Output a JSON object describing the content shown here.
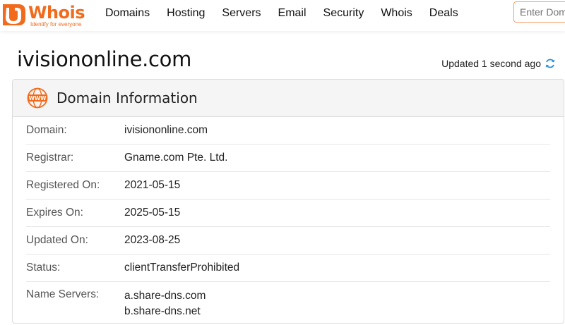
{
  "brand": {
    "name": "Whois",
    "tagline": "Identify for everyone",
    "color": "#f26b1d"
  },
  "nav": {
    "items": [
      "Domains",
      "Hosting",
      "Servers",
      "Email",
      "Security",
      "Whois",
      "Deals"
    ]
  },
  "search": {
    "placeholder": "Enter Domain"
  },
  "page": {
    "title": "ivisiononline.com",
    "updated": "Updated 1 second ago"
  },
  "domain_info": {
    "heading": "Domain Information",
    "icon": "www-icon",
    "rows": [
      {
        "label": "Domain:",
        "value": "ivisiononline.com"
      },
      {
        "label": "Registrar:",
        "value": "Gname.com Pte. Ltd."
      },
      {
        "label": "Registered On:",
        "value": "2021-05-15"
      },
      {
        "label": "Expires On:",
        "value": "2025-05-15"
      },
      {
        "label": "Updated On:",
        "value": "2023-08-25"
      },
      {
        "label": "Status:",
        "value": "clientTransferProhibited"
      }
    ],
    "name_servers": {
      "label": "Name Servers:",
      "values": [
        "a.share-dns.com",
        "b.share-dns.net"
      ]
    }
  },
  "colors": {
    "accent": "#f26b1d",
    "refresh": "#2a8fd6"
  }
}
